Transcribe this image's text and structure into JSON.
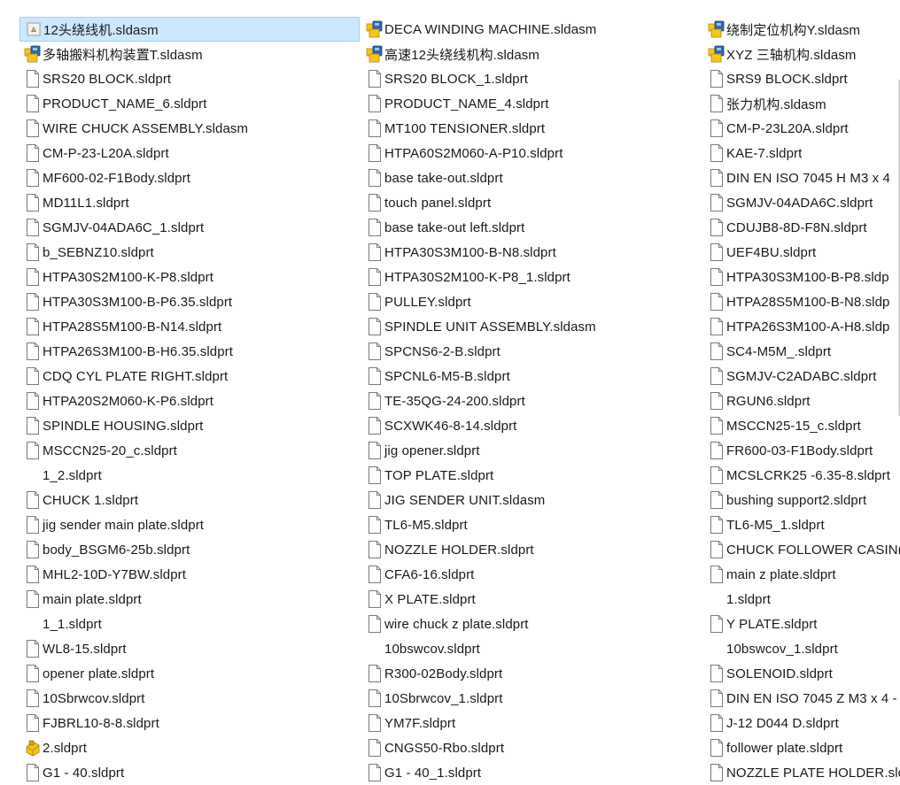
{
  "colors": {
    "selection_bg": "#cce8ff",
    "selection_border": "#99d1ff",
    "text": "#1a1a1a",
    "assembly_icon_blue": "#2f66b3",
    "assembly_icon_yellow": "#f5c518"
  },
  "columns": [
    {
      "items": [
        {
          "label": "12头绕线机.sldasm",
          "icon": "assembly-drawing-icon",
          "selected": true
        },
        {
          "label": "多轴搬料机构装置T.sldasm",
          "icon": "assembly-icon"
        },
        {
          "label": "SRS20 BLOCK.sldprt",
          "icon": "file-icon"
        },
        {
          "label": "PRODUCT_NAME_6.sldprt",
          "icon": "file-icon"
        },
        {
          "label": "WIRE CHUCK ASSEMBLY.sldasm",
          "icon": "file-icon"
        },
        {
          "label": "CM-P-23-L20A.sldprt",
          "icon": "file-icon"
        },
        {
          "label": "MF600-02-F1Body.sldprt",
          "icon": "file-icon"
        },
        {
          "label": "MD11L1.sldprt",
          "icon": "file-icon"
        },
        {
          "label": "SGMJV-04ADA6C_1.sldprt",
          "icon": "file-icon"
        },
        {
          "label": "b_SEBNZ10.sldprt",
          "icon": "file-icon"
        },
        {
          "label": "HTPA30S2M100-K-P8.sldprt",
          "icon": "file-icon"
        },
        {
          "label": "HTPA30S3M100-B-P6.35.sldprt",
          "icon": "file-icon"
        },
        {
          "label": "HTPA28S5M100-B-N14.sldprt",
          "icon": "file-icon"
        },
        {
          "label": "HTPA26S3M100-B-H6.35.sldprt",
          "icon": "file-icon"
        },
        {
          "label": "CDQ CYL PLATE RIGHT.sldprt",
          "icon": "file-icon"
        },
        {
          "label": "HTPA20S2M060-K-P6.sldprt",
          "icon": "file-icon"
        },
        {
          "label": "SPINDLE HOUSING.sldprt",
          "icon": "file-icon"
        },
        {
          "label": "MSCCN25-20_c.sldprt",
          "icon": "file-icon"
        },
        {
          "label": "1_2.sldprt",
          "icon": "none"
        },
        {
          "label": "CHUCK 1.sldprt",
          "icon": "file-icon"
        },
        {
          "label": "jig sender main plate.sldprt",
          "icon": "file-icon"
        },
        {
          "label": "body_BSGM6-25b.sldprt",
          "icon": "file-icon"
        },
        {
          "label": "MHL2-10D-Y7BW.sldprt",
          "icon": "file-icon"
        },
        {
          "label": "main plate.sldprt",
          "icon": "file-icon"
        },
        {
          "label": "1_1.sldprt",
          "icon": "none"
        },
        {
          "label": "WL8-15.sldprt",
          "icon": "file-icon"
        },
        {
          "label": "opener plate.sldprt",
          "icon": "file-icon"
        },
        {
          "label": "10Sbrwcov.sldprt",
          "icon": "file-icon"
        },
        {
          "label": "FJBRL10-8-8.sldprt",
          "icon": "file-icon"
        },
        {
          "label": "2.sldprt",
          "icon": "part-icon"
        },
        {
          "label": "G1 - 40.sldprt",
          "icon": "file-icon"
        }
      ]
    },
    {
      "items": [
        {
          "label": "DECA WINDING MACHINE.sldasm",
          "icon": "assembly-icon"
        },
        {
          "label": "高速12头绕线机构.sldasm",
          "icon": "assembly-icon"
        },
        {
          "label": "SRS20 BLOCK_1.sldprt",
          "icon": "file-icon"
        },
        {
          "label": "PRODUCT_NAME_4.sldprt",
          "icon": "file-icon"
        },
        {
          "label": "MT100 TENSIONER.sldprt",
          "icon": "file-icon"
        },
        {
          "label": "HTPA60S2M060-A-P10.sldprt",
          "icon": "file-icon"
        },
        {
          "label": "base take-out.sldprt",
          "icon": "file-icon"
        },
        {
          "label": "touch panel.sldprt",
          "icon": "file-icon"
        },
        {
          "label": "base take-out left.sldprt",
          "icon": "file-icon"
        },
        {
          "label": "HTPA30S3M100-B-N8.sldprt",
          "icon": "file-icon"
        },
        {
          "label": "HTPA30S2M100-K-P8_1.sldprt",
          "icon": "file-icon"
        },
        {
          "label": "PULLEY.sldprt",
          "icon": "file-icon"
        },
        {
          "label": "SPINDLE UNIT ASSEMBLY.sldasm",
          "icon": "file-icon"
        },
        {
          "label": "SPCNS6-2-B.sldprt",
          "icon": "file-icon"
        },
        {
          "label": "SPCNL6-M5-B.sldprt",
          "icon": "file-icon"
        },
        {
          "label": "TE-35QG-24-200.sldprt",
          "icon": "file-icon"
        },
        {
          "label": "SCXWK46-8-14.sldprt",
          "icon": "file-icon"
        },
        {
          "label": "jig opener.sldprt",
          "icon": "file-icon"
        },
        {
          "label": "TOP PLATE.sldprt",
          "icon": "file-icon"
        },
        {
          "label": "JIG SENDER UNIT.sldasm",
          "icon": "file-icon"
        },
        {
          "label": "TL6-M5.sldprt",
          "icon": "file-icon"
        },
        {
          "label": "NOZZLE HOLDER.sldprt",
          "icon": "file-icon"
        },
        {
          "label": "CFA6-16.sldprt",
          "icon": "file-icon"
        },
        {
          "label": "X PLATE.sldprt",
          "icon": "file-icon"
        },
        {
          "label": "wire chuck z plate.sldprt",
          "icon": "file-icon"
        },
        {
          "label": "10bswcov.sldprt",
          "icon": "none"
        },
        {
          "label": "R300-02Body.sldprt",
          "icon": "file-icon"
        },
        {
          "label": "10Sbrwcov_1.sldprt",
          "icon": "file-icon"
        },
        {
          "label": "YM7F.sldprt",
          "icon": "file-icon"
        },
        {
          "label": "CNGS50-Rbo.sldprt",
          "icon": "file-icon"
        },
        {
          "label": "G1 - 40_1.sldprt",
          "icon": "file-icon"
        }
      ]
    },
    {
      "items": [
        {
          "label": "绕制定位机构Y.sldasm",
          "icon": "assembly-icon"
        },
        {
          "label": "XYZ  三轴机构.sldasm",
          "icon": "assembly-icon"
        },
        {
          "label": "SRS9 BLOCK.sldprt",
          "icon": "file-icon"
        },
        {
          "label": "张力机构.sldasm",
          "icon": "file-icon"
        },
        {
          "label": "CM-P-23L20A.sldprt",
          "icon": "file-icon"
        },
        {
          "label": "KAE-7.sldprt",
          "icon": "file-icon"
        },
        {
          "label": "DIN EN ISO 7045 H M3 x 4",
          "icon": "file-icon"
        },
        {
          "label": "SGMJV-04ADA6C.sldprt",
          "icon": "file-icon"
        },
        {
          "label": "CDUJB8-8D-F8N.sldprt",
          "icon": "file-icon"
        },
        {
          "label": "UEF4BU.sldprt",
          "icon": "file-icon"
        },
        {
          "label": "HTPA30S3M100-B-P8.sldp",
          "icon": "file-icon"
        },
        {
          "label": "HTPA28S5M100-B-N8.sldp",
          "icon": "file-icon"
        },
        {
          "label": "HTPA26S3M100-A-H8.sldp",
          "icon": "file-icon"
        },
        {
          "label": "SC4-M5M_.sldprt",
          "icon": "file-icon"
        },
        {
          "label": "SGMJV-C2ADABC.sldprt",
          "icon": "file-icon"
        },
        {
          "label": "RGUN6.sldprt",
          "icon": "file-icon"
        },
        {
          "label": "MSCCN25-15_c.sldprt",
          "icon": "file-icon"
        },
        {
          "label": "FR600-03-F1Body.sldprt",
          "icon": "file-icon"
        },
        {
          "label": "MCSLCRK25 -6.35-8.sldprt",
          "icon": "file-icon"
        },
        {
          "label": "bushing support2.sldprt",
          "icon": "file-icon"
        },
        {
          "label": "TL6-M5_1.sldprt",
          "icon": "file-icon"
        },
        {
          "label": "CHUCK FOLLOWER CASIN(",
          "icon": "file-icon"
        },
        {
          "label": "main z plate.sldprt",
          "icon": "file-icon"
        },
        {
          "label": "1.sldprt",
          "icon": "none"
        },
        {
          "label": "Y PLATE.sldprt",
          "icon": "file-icon"
        },
        {
          "label": "10bswcov_1.sldprt",
          "icon": "none"
        },
        {
          "label": "SOLENOID.sldprt",
          "icon": "file-icon"
        },
        {
          "label": "DIN EN ISO 7045 Z M3 x 4 -",
          "icon": "file-icon"
        },
        {
          "label": "J-12 D044 D.sldprt",
          "icon": "file-icon"
        },
        {
          "label": "follower plate.sldprt",
          "icon": "file-icon"
        },
        {
          "label": "NOZZLE PLATE HOLDER.slc",
          "icon": "file-icon"
        }
      ]
    }
  ]
}
